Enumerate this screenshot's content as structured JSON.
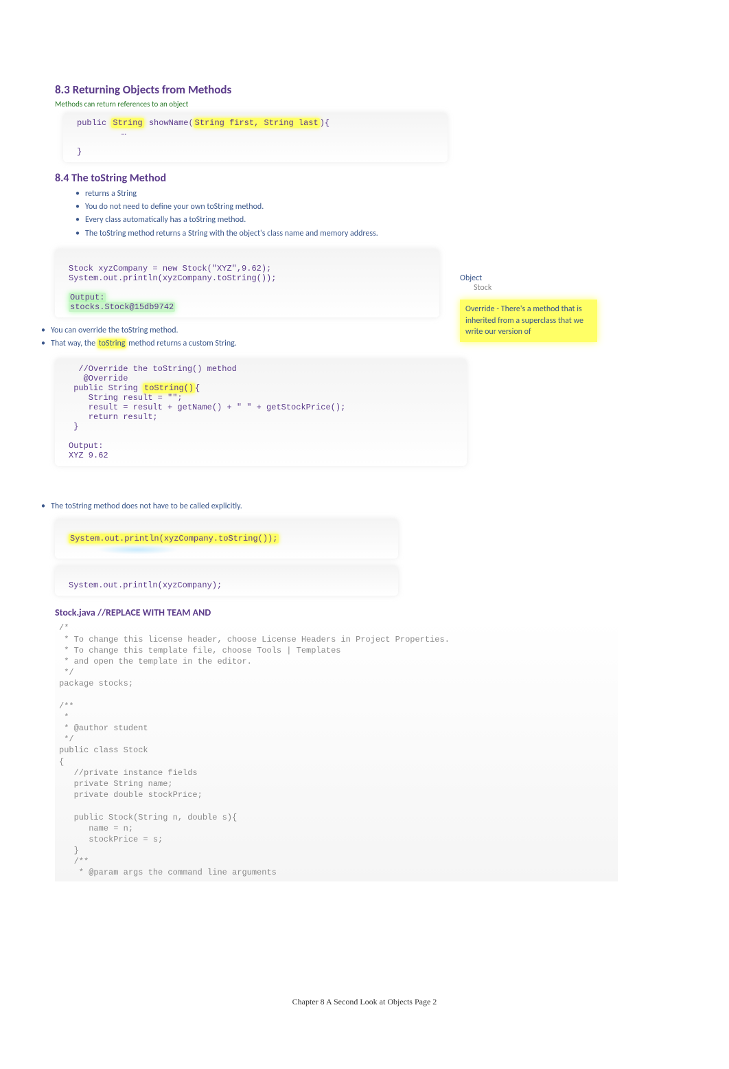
{
  "section83": {
    "title": "8.3 Returning Objects from Methods",
    "subtitle": "Methods can return references to an object",
    "code": {
      "line1_pre": "public ",
      "line1_hl1": "String",
      "line1_mid": " showName(",
      "line1_hl2": "String first, String last",
      "line1_post": "){",
      "line2": "         …",
      "line3": "}"
    }
  },
  "section84": {
    "title": "8.4 The toString Method",
    "bullets": [
      "returns a String",
      "You do not need to define your own toString method.",
      "Every class automatically has a toString method.",
      "The toString method returns a String with the object's class name and memory address."
    ],
    "code1": {
      "l1": "Stock xyzCompany = new Stock(\"XYZ\",9.62);",
      "l2": "System.out.println(xyzCompany.toString());",
      "blank": "",
      "out_label": "Output:",
      "out_val": "stocks.Stock@15db9742"
    },
    "override_bullets": [
      "You can override the toString method.",
      "That way, the toString method returns a custom String."
    ],
    "right_obj": "Object",
    "right_stock": "Stock",
    "right_note": "Override - There's a method that is inherited from a superclass that we write our version of",
    "code2": {
      "c1": "  //Override the toString() method",
      "c2": "   @Override",
      "c3_a": " public String ",
      "c3_hl": "toString()",
      "c3_b": "{",
      "c4": "    String result = \"\";",
      "c5": "    result = result + getName() + \" \" + getStockPrice();",
      "c6": "    return result;",
      "c7": " }",
      "blank": "",
      "out_label": "Output:",
      "out_val": "XYZ 9.62"
    },
    "explicit_bullet": "The toString method does not have to be called explicitly.",
    "code3": {
      "l1": "System.out.println(xyzCompany.toString());",
      "l2": "System.out.println(xyzCompany);"
    }
  },
  "stock": {
    "title": "Stock.java //REPLACE WITH TEAM AND",
    "code": "/*\n * To change this license header, choose License Headers in Project Properties.\n * To change this template file, choose Tools | Templates\n * and open the template in the editor.\n */\npackage stocks;\n\n/**\n *\n * @author student\n */\npublic class Stock\n{\n   //private instance fields\n   private String name;\n   private double stockPrice;\n\n   public Stock(String n, double s){\n      name = n;\n      stockPrice = s;\n   }\n   /**\n    * @param args the command line arguments"
  },
  "footer": "Chapter 8 A Second Look at Objects Page 2"
}
